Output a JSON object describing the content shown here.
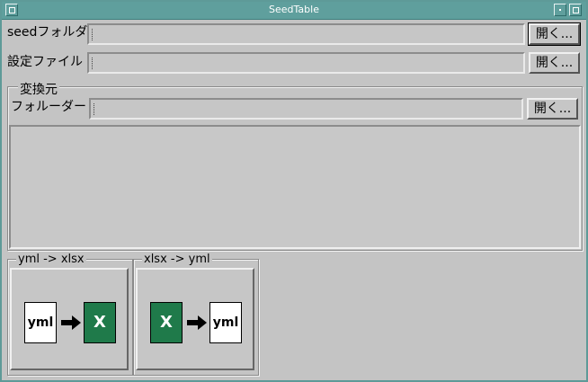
{
  "window": {
    "title": "SeedTable"
  },
  "seed_folder": {
    "label": "seedフォルダ",
    "value": "",
    "open_label": "開く..."
  },
  "settings_file": {
    "label": "設定ファイル",
    "value": "",
    "open_label": "開く..."
  },
  "source_group": {
    "legend": "変換元",
    "folder_label": "フォルーダー",
    "folder_value": "",
    "open_label": "開く..."
  },
  "converters": [
    {
      "legend": "yml -> xlsx",
      "from": "yml",
      "to": "X"
    },
    {
      "legend": "xlsx -> yml",
      "from": "X",
      "to": "yml"
    }
  ],
  "colors": {
    "titlebar": "#5f9f9d",
    "excel_green": "#1f7a4a",
    "window_bg": "#c4c4c4"
  },
  "icons": [
    "window-menu-icon",
    "minimize-icon",
    "maximize-icon",
    "arrow-right-icon",
    "yml-file-icon",
    "excel-icon"
  ]
}
